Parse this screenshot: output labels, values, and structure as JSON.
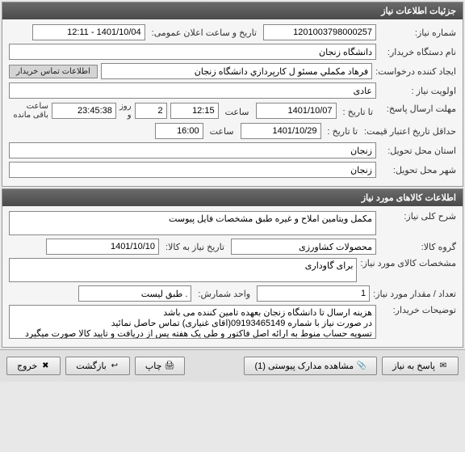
{
  "panel1": {
    "title": "جزئیات اطلاعات نیاز",
    "need_no_label": "شماره نیاز:",
    "need_no": "1201003798000257",
    "announce_label": "تاریخ و ساعت اعلان عمومی:",
    "announce_value": "1401/10/04 - 12:11",
    "buyer_org_label": "نام دستگاه خریدار:",
    "buyer_org": "دانشگاه زنجان",
    "creator_label": "ایجاد کننده درخواست:",
    "creator": "فرهاد مکملي مسئو ل کارپردازي دانشگاه زنجان",
    "contact_btn": "اطلاعات تماس خریدار",
    "priority_label": "اولویت نیاز :",
    "priority": "عادی",
    "deadline_label": "مهلت ارسال پاسخ:",
    "to_date_label": "تا تاریخ :",
    "deadline_date": "1401/10/07",
    "time_label": "ساعت",
    "deadline_time": "12:15",
    "days_remaining": "2",
    "days_label": "روز و",
    "hours_remaining": "23:45:38",
    "remaining_label": "ساعت باقی مانده",
    "validity_label": "حداقل تاریخ اعتبار قیمت:",
    "validity_date": "1401/10/29",
    "validity_time": "16:00",
    "province_label": "استان محل تحویل:",
    "province": "زنجان",
    "city_label": "شهر محل تحویل:",
    "city": "زنجان"
  },
  "panel2": {
    "title": "اطلاعات کالاهای مورد نیاز",
    "desc_label": "شرح کلی نیاز:",
    "desc": "مکمل ویتامین املاح و غیره طبق مشخصات فایل پیوست",
    "group_label": "گروه کالا:",
    "group": "محصولات کشاورزی",
    "need_date_label": "تاریخ نیاز به کالا:",
    "need_date": "1401/10/10",
    "spec_label": "مشخصات کالای مورد نیاز:",
    "spec": "برای گاوداری",
    "qty_label": "تعداد / مقدار مورد نیاز:",
    "qty": "1",
    "unit_label": "واحد شمارش:",
    "unit": ". طبق لیست",
    "buyer_note_label": "توضیحات خریدار:",
    "buyer_note": "هزینه ارسال تا دانشگاه زنجان بعهده تامین کننده می باشد\nدر صورت نیاز با شماره 09193465149(اقای غنیاری) تماس حاصل نمائید\nتسویه حساب منوط به ارائه اصل فاکتور و طی یک هفته پس از دریافت و تایید کالا صورت میگیرد"
  },
  "buttons": {
    "reply": "پاسخ به نیاز",
    "attachments": "مشاهده مدارک پیوستی (1)",
    "print": "چاپ",
    "back": "بازگشت",
    "exit": "خروج"
  }
}
